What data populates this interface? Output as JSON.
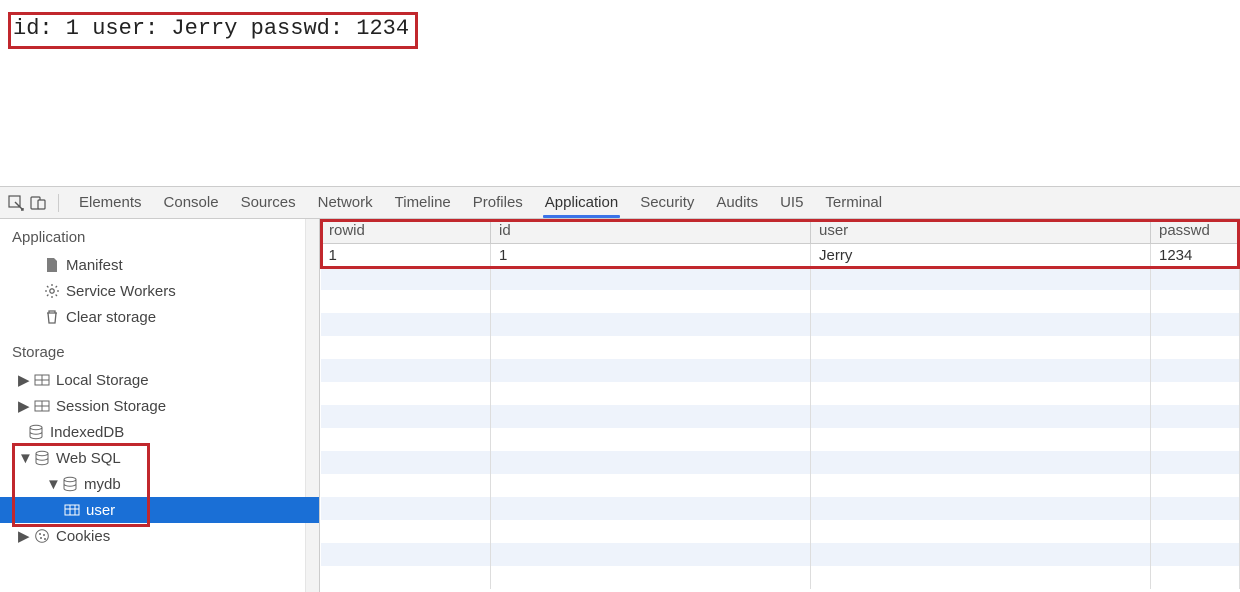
{
  "page_output": "id: 1 user: Jerry passwd: 1234",
  "devtools": {
    "tabs": [
      "Elements",
      "Console",
      "Sources",
      "Network",
      "Timeline",
      "Profiles",
      "Application",
      "Security",
      "Audits",
      "UI5",
      "Terminal"
    ],
    "active_tab": "Application"
  },
  "sidebar": {
    "section_application": "Application",
    "manifest": "Manifest",
    "service_workers": "Service Workers",
    "clear_storage": "Clear storage",
    "section_storage": "Storage",
    "local_storage": "Local Storage",
    "session_storage": "Session Storage",
    "indexeddb": "IndexedDB",
    "web_sql": "Web SQL",
    "mydb": "mydb",
    "user_table": "user",
    "cookies": "Cookies"
  },
  "table": {
    "columns": [
      "rowid",
      "id",
      "user",
      "passwd"
    ],
    "rows": [
      {
        "rowid": "1",
        "id": "1",
        "user": "Jerry",
        "passwd": "1234"
      }
    ]
  }
}
